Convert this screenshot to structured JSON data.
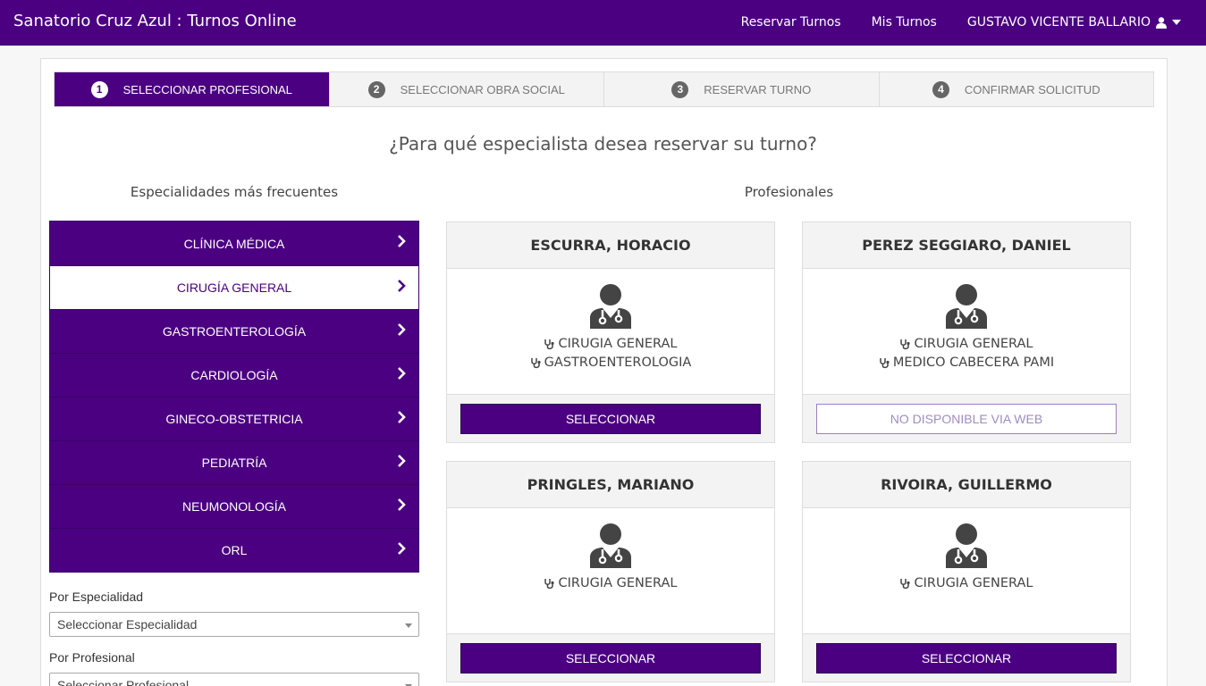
{
  "app": {
    "title": "Sanatorio Cruz Azul : Turnos Online",
    "nav": {
      "reservar": "Reservar Turnos",
      "mis_turnos": "Mis Turnos",
      "user": "GUSTAVO VICENTE BALLARIO"
    }
  },
  "steps": [
    {
      "num": "1",
      "label": "SELECCIONAR PROFESIONAL"
    },
    {
      "num": "2",
      "label": "SELECCIONAR OBRA SOCIAL"
    },
    {
      "num": "3",
      "label": "RESERVAR TURNO"
    },
    {
      "num": "4",
      "label": "CONFIRMAR SOLICITUD"
    }
  ],
  "question": "¿Para qué especialista desea reservar su turno?",
  "specialties_heading": "Especialidades más frecuentes",
  "professionals_heading": "Profesionales",
  "specialties": [
    {
      "label": "CLÍNICA MÉDICA"
    },
    {
      "label": "CIRUGÍA GENERAL"
    },
    {
      "label": "GASTROENTEROLOGÍA"
    },
    {
      "label": "CARDIOLOGÍA"
    },
    {
      "label": "GINECO-OBSTETRICIA"
    },
    {
      "label": "PEDIATRÍA"
    },
    {
      "label": "NEUMONOLOGÍA"
    },
    {
      "label": "ORL"
    }
  ],
  "filters": {
    "by_specialty_label": "Por Especialidad",
    "by_specialty_value": "Seleccionar Especialidad",
    "by_professional_label": "Por Profesional",
    "by_professional_value": "Seleccionar Profesional"
  },
  "professionals": [
    {
      "name": "ESCURRA, HORACIO",
      "specs": [
        "CIRUGIA GENERAL",
        "GASTROENTEROLOGIA"
      ],
      "button": "SELECCIONAR"
    },
    {
      "name": "PEREZ SEGGIARO, DANIEL",
      "specs": [
        "CIRUGIA GENERAL",
        "MEDICO CABECERA PAMI"
      ],
      "button": "NO DISPONIBLE VIA WEB"
    },
    {
      "name": "PRINGLES, MARIANO",
      "specs": [
        "CIRUGIA GENERAL"
      ],
      "button": "SELECCIONAR"
    },
    {
      "name": "RIVOIRA, GUILLERMO",
      "specs": [
        "CIRUGIA GENERAL"
      ],
      "button": "SELECCIONAR"
    }
  ],
  "colors": {
    "brand": "#4b0082",
    "disabled_text": "#a08cc0"
  }
}
